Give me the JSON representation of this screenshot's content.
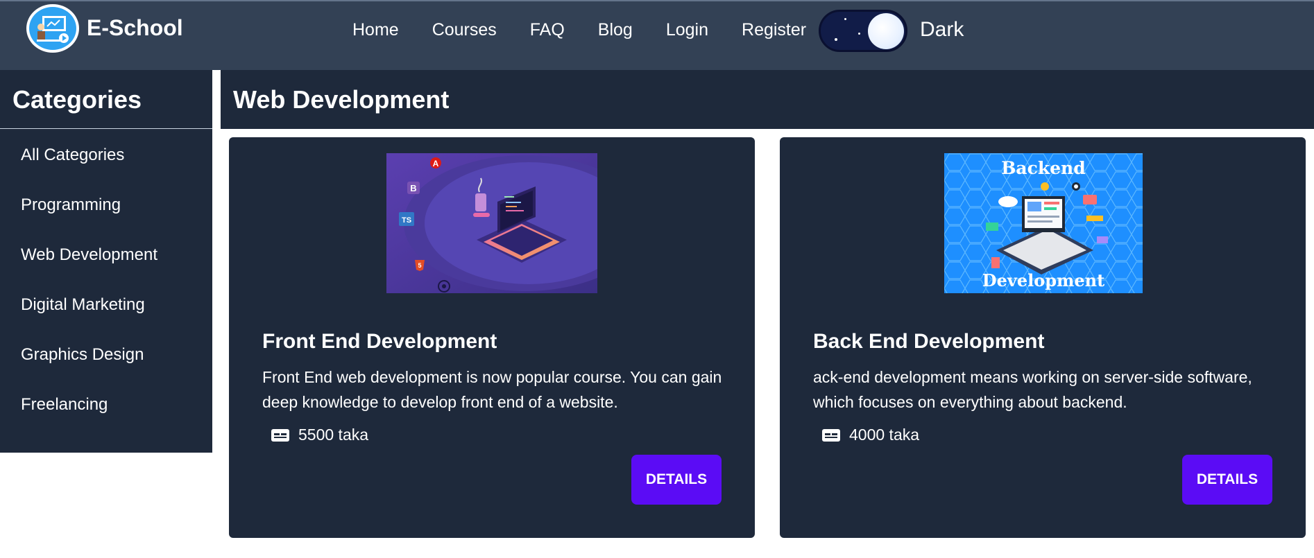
{
  "navbar": {
    "brand": "E-School",
    "links": [
      "Home",
      "Courses",
      "FAQ",
      "Blog",
      "Login",
      "Register"
    ],
    "theme_label": "Dark",
    "theme_mode": "dark"
  },
  "sidebar": {
    "title": "Categories",
    "items": [
      "All Categories",
      "Programming",
      "Web Development",
      "Digital Marketing",
      "Graphics Design",
      "Freelancing"
    ]
  },
  "main": {
    "title": "Web Development",
    "courses": [
      {
        "title": "Front End Development",
        "description": "Front End web development is now popular course. You can gain deep knowledge to develop front end of a website.",
        "price": "5500 taka",
        "button": "DETAILS",
        "image": {
          "name": "front-end-illustration",
          "tech_badges": [
            "A",
            "B",
            "TS",
            "5"
          ]
        }
      },
      {
        "title": "Back End Development",
        "description": "ack-end development means working on server-side software, which focuses on everything about backend.",
        "price": "4000 taka",
        "button": "DETAILS",
        "image": {
          "name": "backend-illustration",
          "text_top": "Backend",
          "text_bottom": "Development"
        }
      }
    ]
  },
  "colors": {
    "navbar_bg": "#334155",
    "panel_bg": "#1e293b",
    "button_bg": "#5b0cf5",
    "logo_blue": "#2ea3f2"
  }
}
